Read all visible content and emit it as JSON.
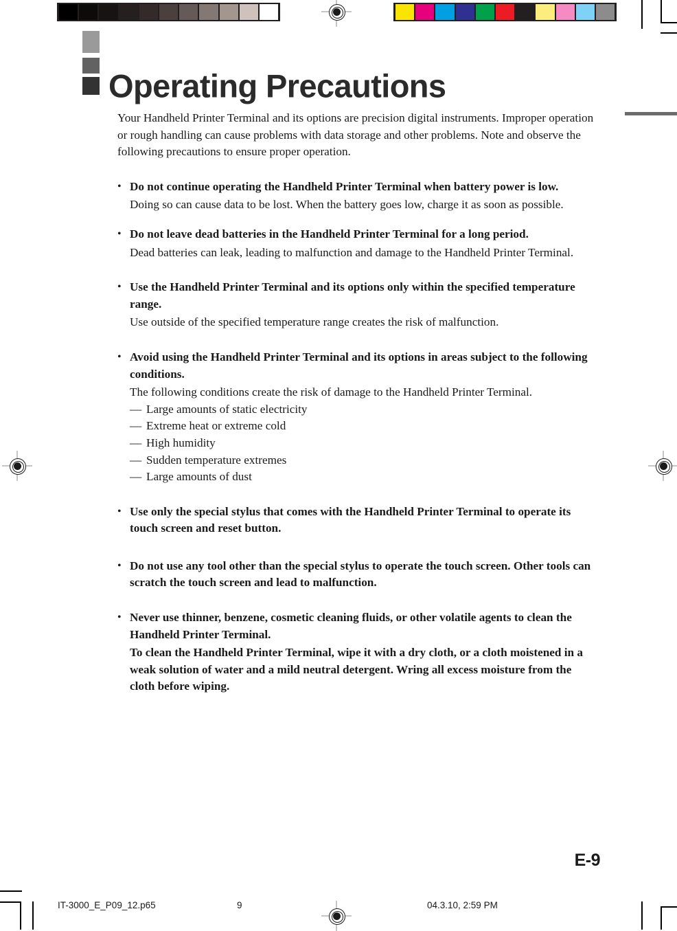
{
  "document": {
    "title": "Operating Precautions",
    "page_number": "E-9"
  },
  "calibration": {
    "grayscale_label": "grayscale-calibration-strip",
    "grayscale_swatches": [
      "#000000",
      "#0d0a0a",
      "#181313",
      "#251f1f",
      "#332a29",
      "#4b403e",
      "#655a57",
      "#847875",
      "#a3968f",
      "#cfc2bd",
      "#ffffff"
    ],
    "color_label": "color-calibration-strip",
    "color_swatches": [
      "#fbe400",
      "#e6007e",
      "#00a0e3",
      "#2e3192",
      "#00a14b",
      "#ed1c24",
      "#231f20",
      "#fbee7f",
      "#f68bc4",
      "#7fd2f5",
      "#8c8c8c"
    ]
  },
  "intro": "Your Handheld Printer Terminal and its options are precision digital instruments. Improper operation or rough handling can cause problems with data storage and other problems. Note and observe the following precautions to ensure proper operation.",
  "bullet_marker": "•",
  "dash_marker": "—",
  "precautions": [
    {
      "heading": "Do not continue operating the Handheld Printer Terminal when battery power is low.",
      "body": "Doing so can cause data to be lost. When the battery goes low, charge it as soon as possible.",
      "body_bold": false
    },
    {
      "heading": "Do not leave dead batteries in the Handheld Printer Terminal for a long period.",
      "body": "Dead batteries can leak, leading to malfunction and damage to the Handheld Printer Terminal.",
      "body_bold": false
    },
    {
      "heading": "Use the Handheld Printer Terminal and its options only within the specified temperature range.",
      "body": "Use outside of the specified temperature range creates the risk of malfunction.",
      "body_bold": false
    },
    {
      "heading": "Avoid using the Handheld Printer Terminal and its options in areas subject to the following conditions.",
      "body": "The following conditions create the risk of damage to the Handheld Printer Terminal.",
      "body_bold": false,
      "conditions": [
        "Large amounts of static electricity",
        "Extreme heat or extreme cold",
        "High humidity",
        "Sudden temperature extremes",
        "Large amounts of dust"
      ]
    },
    {
      "heading": "Use only the special stylus that comes with the Handheld Printer Terminal to operate its touch screen and reset button.",
      "body": "",
      "body_bold": false
    },
    {
      "heading": "Do not use any tool other than the special stylus to operate the touch screen. Other tools can scratch the touch screen and lead to malfunction.",
      "body": "",
      "body_bold": false
    },
    {
      "heading": "Never use thinner, benzene, cosmetic cleaning fluids, or other volatile agents to clean the Handheld Printer Terminal.",
      "body": "To clean the Handheld Printer Terminal, wipe it with a dry cloth, or a cloth moistened in a weak solution of water and a mild neutral detergent. Wring all excess moisture from the cloth before wiping.",
      "body_bold": true
    }
  ],
  "file_footer": {
    "filename": "IT-3000_E_P09_12.p65",
    "page": "9",
    "timestamp": "04.3.10, 2:59 PM"
  }
}
